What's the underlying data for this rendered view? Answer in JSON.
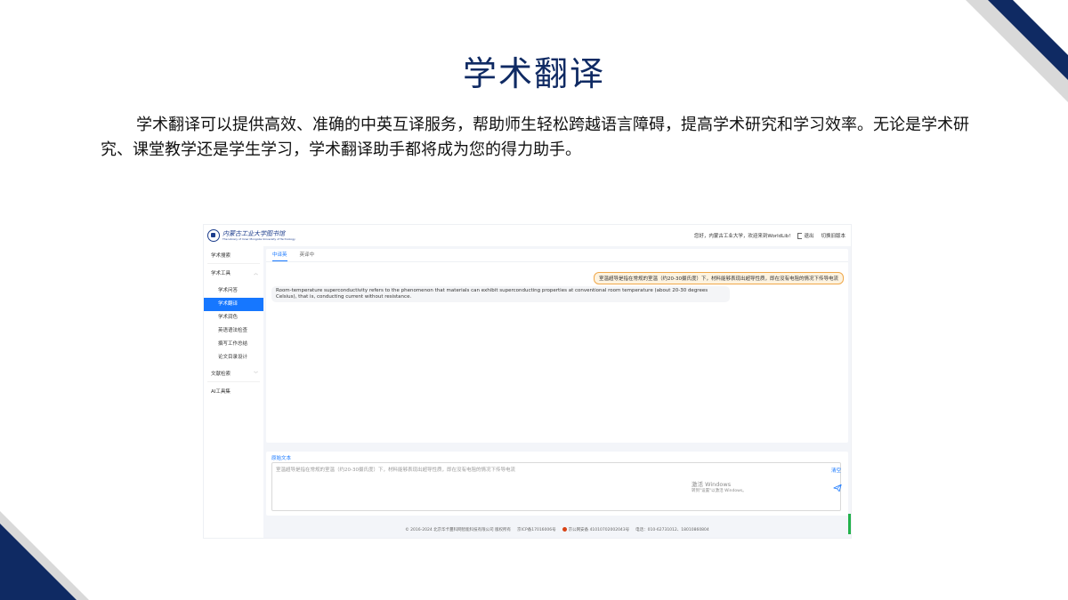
{
  "slide": {
    "title": "学术翻译",
    "description": "学术翻译可以提供高效、准确的中英互译服务，帮助师生轻松跨越语言障碍，提高学术研究和学习效率。无论是学术研究、课堂教学还是学生学习，学术翻译助手都将成为您的得力助手。"
  },
  "header": {
    "logo_cn": "内蒙古工业大学图书馆",
    "logo_en": "The Library of Inner Mongolia University of Technology",
    "greeting": "您好，内蒙古工业大学，欢迎来到WorldLib!",
    "logout_label": "退出",
    "switch_label": "切换旧版本"
  },
  "sidebar": {
    "items": [
      {
        "label": "学术搜索"
      },
      {
        "label": "学术工具"
      },
      {
        "label": "学术问答"
      },
      {
        "label": "学术翻译"
      },
      {
        "label": "学术润色"
      },
      {
        "label": "英语语法检查"
      },
      {
        "label": "撰写工作总结"
      },
      {
        "label": "论文目录设计"
      },
      {
        "label": "文献检索"
      },
      {
        "label": "AI工具集"
      }
    ]
  },
  "tabs": [
    {
      "label": "中译英"
    },
    {
      "label": "英译中"
    }
  ],
  "conversation": {
    "user_message": "室温超导是指在常规的室温（约20-30摄氏度）下，材料能够表现出超导性质，即在没有电阻的情况下传导电流",
    "bot_message": "Room-temperature superconductivity refers to the phenomenon that materials can exhibit superconducting properties at conventional room temperature (about 20-30 degrees Celsius), that is, conducting current without resistance."
  },
  "input": {
    "label": "原始文本",
    "value": "室温超导是指在常规的室温（约20-30摄氏度）下，材料能够表现出超导性质，即在没有电阻的情况下传导电流",
    "clear_label": "清空"
  },
  "watermark": {
    "line1": "激活 Windows",
    "line2": "转到\"设置\"以激活 Windows。"
  },
  "footer": {
    "copyright": "© 2016-2024 北京华卡蔓科网智能科技有限公司 版权所有",
    "icp": "京ICP备17016006号",
    "police": "京公网安备 41010702002043号",
    "phone": "电话：010-62731012、18010860804"
  },
  "colors": {
    "navy": "#0f2a63",
    "accent": "#1677ff",
    "user_bubble": "#fdf3e0"
  }
}
